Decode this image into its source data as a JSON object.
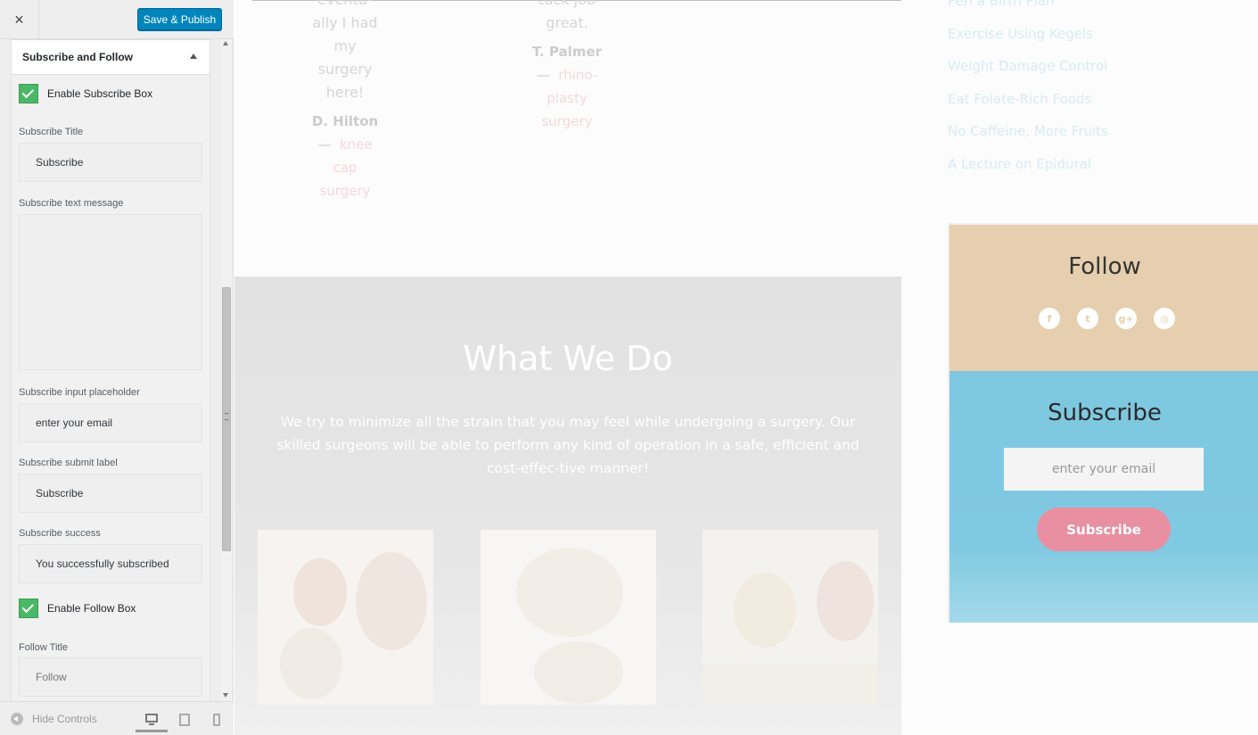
{
  "toolbar": {
    "close_icon": "×",
    "publish_label": "Save & Publish"
  },
  "section": {
    "title": "Subscribe and Follow"
  },
  "fields": {
    "enable_subscribe_label": "Enable Subscribe Box",
    "enable_subscribe_checked": true,
    "subscribe_title_label": "Subscribe Title",
    "subscribe_title_value": "Subscribe",
    "subscribe_text_label": "Subscribe text message",
    "subscribe_text_value": "",
    "subscribe_placeholder_label": "Subscribe input placeholder",
    "subscribe_placeholder_value": "enter your email",
    "subscribe_submit_label": "Subscribe submit label",
    "subscribe_submit_value": "Subscribe",
    "subscribe_success_label": "Subscribe success",
    "subscribe_success_value": "You successfully subscribed",
    "enable_follow_label": "Enable Follow Box",
    "enable_follow_checked": true,
    "follow_title_label": "Follow Title",
    "follow_title_placeholder": "Follow"
  },
  "footer": {
    "hide_controls_label": "Hide Controls",
    "devices": [
      "desktop",
      "tablet",
      "mobile"
    ],
    "active_device": "desktop"
  },
  "preview": {
    "testimonials": [
      {
        "quote_lines": [
          "eventu-",
          "ally I had",
          "my",
          "surgery",
          "here!"
        ],
        "author": "D. Hilton",
        "link_lines": [
          "knee",
          "cap",
          "surgery"
        ]
      },
      {
        "quote_lines": [
          "tuck job",
          "great."
        ],
        "author": "T. Palmer",
        "link_lines": [
          "rhino-",
          "plasty",
          "surgery"
        ]
      }
    ],
    "dash": "—",
    "sidebar_links": [
      "Peri a Birth Plan",
      "Exercise Using Kegels",
      "Weight Damage Control",
      "Eat Folate-Rich Foods",
      "No Caffeine, More Fruits",
      "A Lecture on Epidural"
    ],
    "what_title": "What We Do",
    "what_text": "We try to minimize all the strain that you may feel while undergoing a surgery. Our skilled surgeons will be able to perform any kind of operation in a safe, efficient and cost-effec-tive manner!",
    "follow": {
      "title": "Follow",
      "icons": [
        "facebook-icon",
        "twitter-icon",
        "google-plus-icon",
        "instagram-icon"
      ],
      "glyphs": [
        "f",
        "t",
        "g+",
        "◎"
      ]
    },
    "subscribe": {
      "title": "Subscribe",
      "placeholder": "enter your email",
      "button": "Subscribe"
    }
  },
  "colors": {
    "accent": "#0085ba",
    "check": "#4ab866",
    "follow_bg": "#e6cfae",
    "subscribe_bg": "#7ec7e0",
    "subscribe_btn": "#e88fa1"
  }
}
